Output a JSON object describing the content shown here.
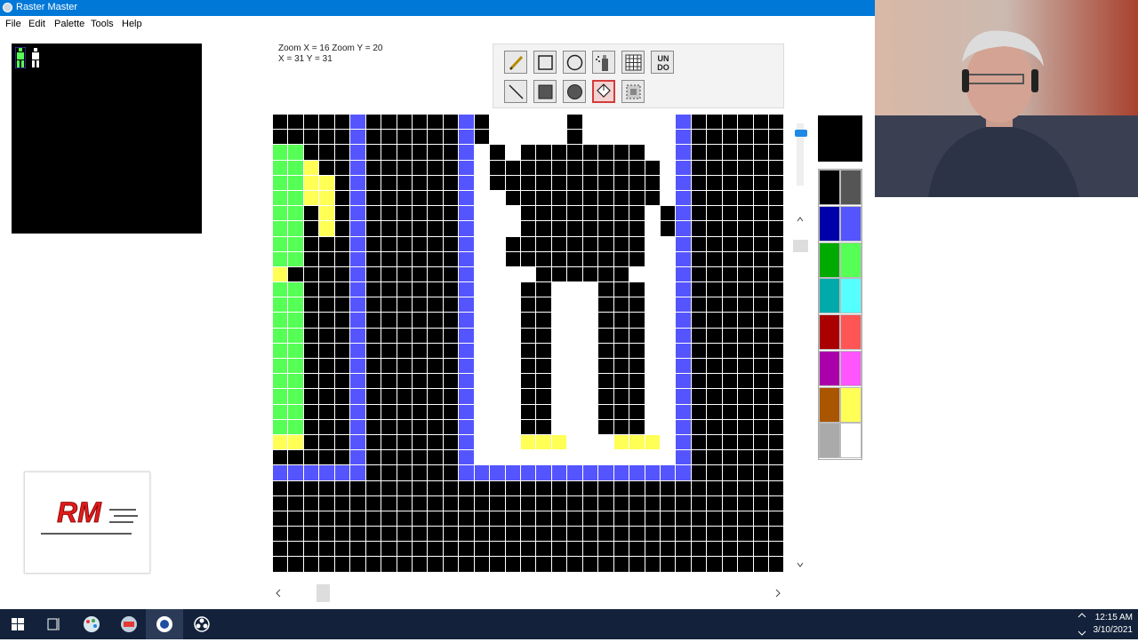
{
  "window": {
    "title": "Raster Master"
  },
  "menu": {
    "items": [
      "File",
      "Edit",
      "Palette",
      "Tools",
      "Help"
    ]
  },
  "status": {
    "zoom": "Zoom X = 16 Zoom Y = 20",
    "coords": "X = 31 Y = 31"
  },
  "toolbar": {
    "row1": [
      "pencil",
      "rectangle",
      "circle",
      "spray",
      "grid",
      "undo"
    ],
    "row2": [
      "line",
      "filled-rectangle",
      "filled-circle",
      "fill-bucket",
      "select"
    ],
    "undo_label": "UN DO",
    "active": "fill-bucket"
  },
  "palette": {
    "current": "#000000",
    "colors": [
      [
        "#000000",
        "#555555"
      ],
      [
        "#0000aa",
        "#5555ff"
      ],
      [
        "#00aa00",
        "#55ff55"
      ],
      [
        "#00aaaa",
        "#55ffff"
      ],
      [
        "#aa0000",
        "#ff5555"
      ],
      [
        "#aa00aa",
        "#ff55ff"
      ],
      [
        "#aa5500",
        "#ffff55"
      ],
      [
        "#aaaaaa",
        "#ffffff"
      ]
    ]
  },
  "canvas": {
    "legend": {
      "K": "#000000",
      "W": "#ffffff",
      "B": "#5555ff",
      "G": "#55ff55",
      "Y": "#ffff55"
    },
    "rows": [
      "KKKKKBKKKKKKBKWWWWWKWWWWWWBKKKKKK",
      "KKKKKBKKKKKKBKWWWWWKWWWWWWBKKKKKK",
      "GGKKKBKKKKKKBWKWKKKKKKKKWWBKKKKKK",
      "GGYKKBKKKKKKBWKKKKKKKKKKKWBKKKKKK",
      "GGYYKBKKKKKKBWKKKKKKKKKKKWBKKKKKK",
      "GGYYKBKKKKKKBWWKKKKKKKKKKWBKKKKKK",
      "GGKYKBKKKKKKBWWWKKKKKKKKWKBKKKKKK",
      "GGKYKBKKKKKKBWWWKKKKKKKKWKBKKKKKK",
      "GGKKKBKKKKKKBWWKKKKKKKKKWWBKKKKKK",
      "GGKKKBKKKKKKBWWKKKKKKKKKWWBKKKKKK",
      "YKKKKBKKKKKKBWWWWKKKKKKWWWBKKKKKK",
      "GGKKKBKKKKKKBWWWKKWWWKKKWWBKKKKKK",
      "GGKKKBKKKKKKBWWWKKWWWKKKWWBKKKKKK",
      "GGKKKBKKKKKKBWWWKKWWWKKKWWBKKKKKK",
      "GGKKKBKKKKKKBWWWKKWWWKKKWWBKKKKKK",
      "GGKKKBKKKKKKBWWWKKWWWKKKWWBKKKKKK",
      "GGKKKBKKKKKKBWWWKKWWWKKKWWBKKKKKK",
      "GGKKKBKKKKKKBWWWKKWWWKKKWWBKKKKKK",
      "GGKKKBKKKKKKBWWWKKWWWKKKWWBKKKKKK",
      "GGKKKBKKKKKKBWWWKKWWWKKKWWBKKKKKK",
      "GGKKKBKKKKKKBWWWKKWWWKKKWWBKKKKKK",
      "YYKKKBKKKKKKBWWWYYYWWWYYYWBKKKKKK",
      "KKKKKBKKKKKKBWWWWWWWWWWWWWBKKKKKK",
      "BBBBBBKKKKKKBBBBBBBBBBBBBBBKKKKKK",
      "KKKKKKKKKKKKKKKKKKKKKKKKKKKKKKKKK",
      "KKKKKKKKKKKKKKKKKKKKKKKKKKKKKKKKK",
      "KKKKKKKKKKKKKKKKKKKKKKKKKKKKKKKKK",
      "KKKKKKKKKKKKKKKKKKKKKKKKKKKKKKKKK",
      "KKKKKKKKKKKKKKKKKKKKKKKKKKKKKKKKK",
      "KKKKKKKKKKKKKKKKKKKKKKKKKKKKKKKKK"
    ]
  },
  "logo": {
    "text": "RM"
  },
  "taskbar": {
    "apps": [
      "start-icon",
      "task-view-icon",
      "paint-icon",
      "raster-master-app-icon",
      "settings-app-icon",
      "obs-icon"
    ],
    "time": "12:15 AM",
    "date": "3/10/2021"
  }
}
